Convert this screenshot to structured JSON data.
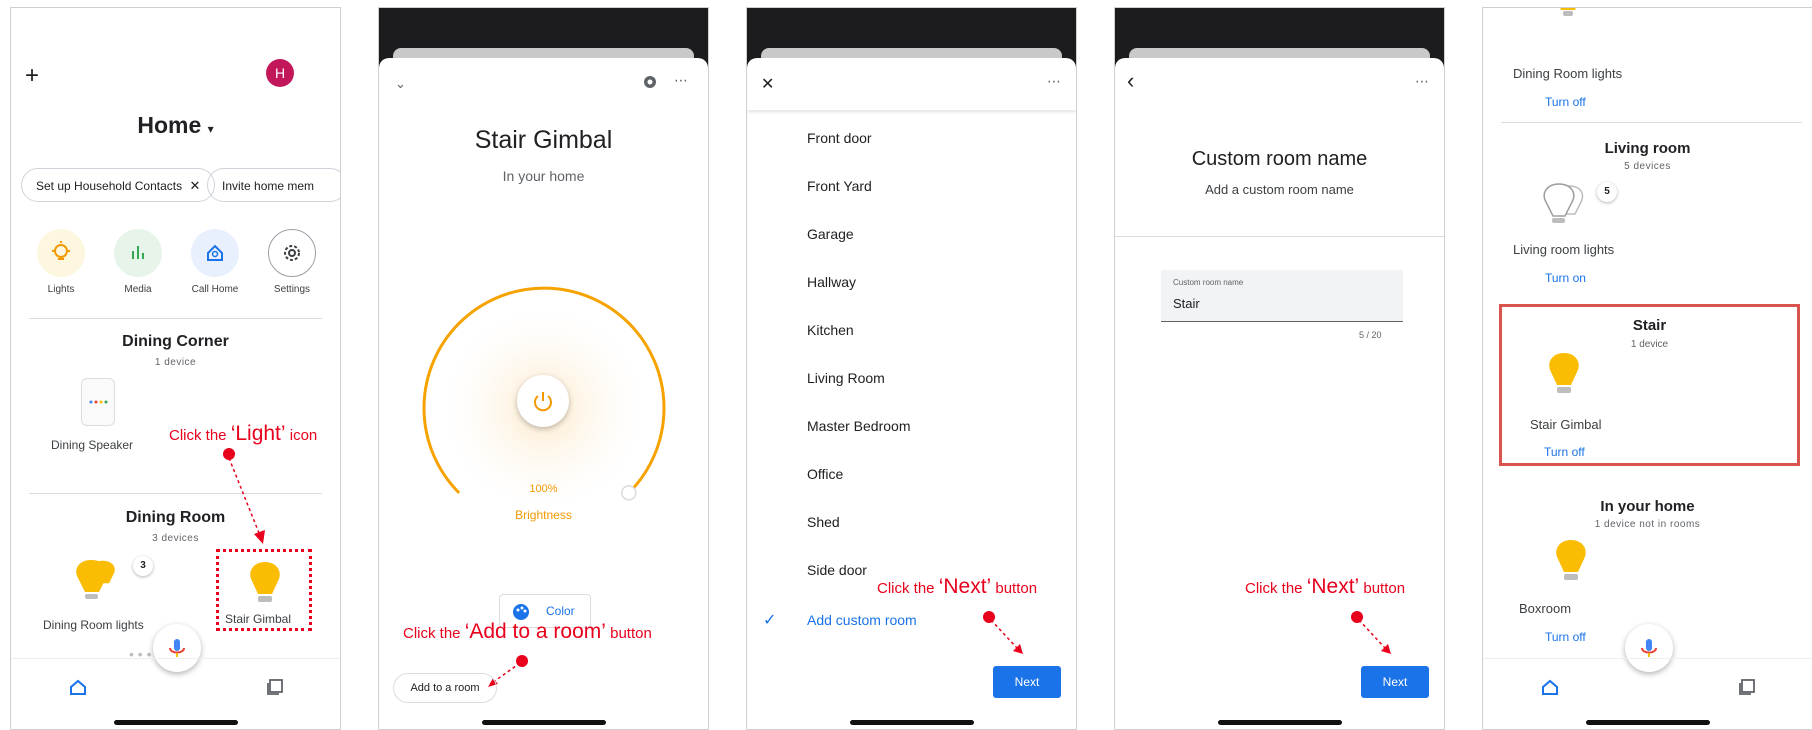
{
  "panel1": {
    "add_icon": "plus-icon",
    "avatar_letter": "H",
    "title": "Home",
    "chips": [
      "Set up Household Contacts",
      "Invite home mem"
    ],
    "shortcuts": [
      {
        "label": "Lights",
        "icon": "bulb-icon",
        "color": "#fbbc04"
      },
      {
        "label": "Media",
        "icon": "equalizer-icon",
        "color": "#34a853"
      },
      {
        "label": "Call Home",
        "icon": "call-home-icon",
        "color": "#1a73e8"
      },
      {
        "label": "Settings",
        "icon": "gear-icon",
        "color": "#5f6368"
      }
    ],
    "room1": {
      "name": "Dining Corner",
      "count": "1 device",
      "device": "Dining Speaker"
    },
    "room2": {
      "name": "Dining Room",
      "count": "3 devices",
      "device1": "Dining Room lights",
      "badge": "3",
      "device2": "Stair Gimbal"
    },
    "annotation": {
      "prefix": "Click the ",
      "emph": "‘Light’",
      "suffix": " icon"
    }
  },
  "panel2": {
    "title": "Stair Gimbal",
    "subtitle": "In your home",
    "brightness_value": "100%",
    "brightness_label": "Brightness",
    "brightness_level": 1.0,
    "color_label": "Color",
    "add_room_label": "Add to a room",
    "annotation": {
      "prefix": "Click the ",
      "emph": "‘Add to a room’",
      "suffix": " button"
    }
  },
  "panel3": {
    "rooms": [
      "Front door",
      "Front Yard",
      "Garage",
      "Hallway",
      "Kitchen",
      "Living Room",
      "Master Bedroom",
      "Office",
      "Shed",
      "Side door"
    ],
    "custom": "Add custom room",
    "next_label": "Next",
    "annotation": {
      "prefix": "Click the ",
      "emph": "‘Next’",
      "suffix": " button"
    }
  },
  "panel4": {
    "title": "Custom room name",
    "subtitle": "Add a custom room name",
    "field_label": "Custom room name",
    "field_value": "Stair",
    "counter": "5 / 20",
    "next_label": "Next",
    "annotation": {
      "prefix": "Click the ",
      "emph": "‘Next’",
      "suffix": " button"
    }
  },
  "panel5": {
    "dining_lights": "Dining Room lights",
    "turn_off": "Turn off",
    "living": {
      "name": "Living room",
      "count": "5 devices",
      "badge": "5",
      "device": "Living room lights",
      "action": "Turn on"
    },
    "stair": {
      "name": "Stair",
      "count": "1 device",
      "device": "Stair Gimbal",
      "action": "Turn off"
    },
    "inhome": {
      "name": "In your home",
      "count": "1 device not in rooms",
      "device": "Boxroom",
      "action": "Turn off"
    }
  },
  "colors": {
    "accent": "#1a73e8",
    "annotation": "#e8001c",
    "bulb": "#fbbc04",
    "brightness": "#f29900"
  }
}
